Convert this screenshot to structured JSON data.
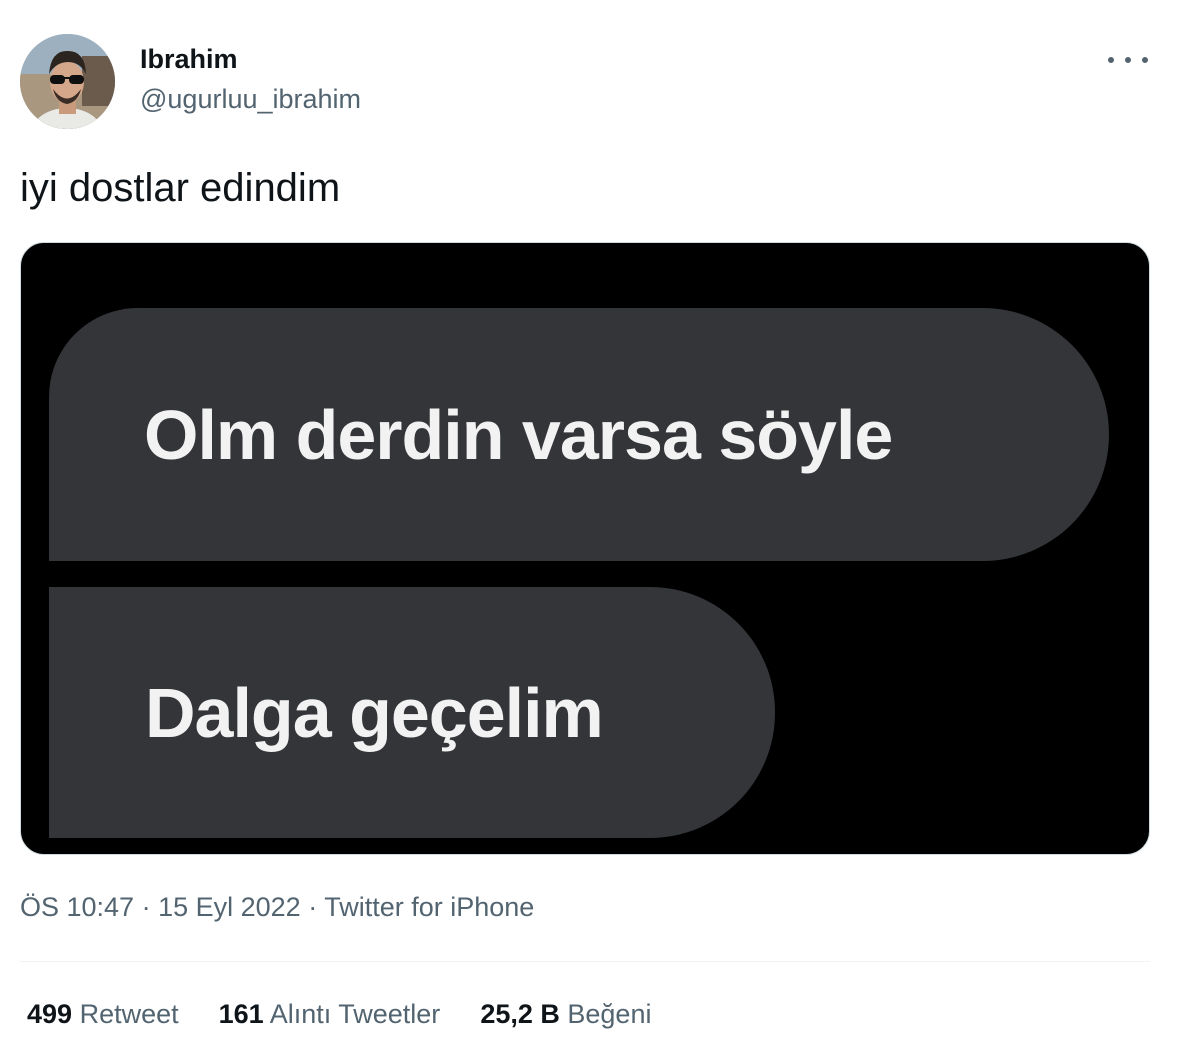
{
  "tweet": {
    "author": {
      "display_name": "Ibrahim",
      "handle": "@ugurluu_ibrahim"
    },
    "text": "iyi dostlar edindim",
    "media": {
      "messages": [
        "Olm derdin varsa söyle",
        "Dalga geçelim"
      ]
    },
    "meta": {
      "time": "ÖS 10:47",
      "separator": " · ",
      "date": "15 Eyl 2022",
      "source": "Twitter for iPhone"
    },
    "stats": [
      {
        "count": "499",
        "label": "Retweet"
      },
      {
        "count": "161",
        "label": "Alıntı Tweetler"
      },
      {
        "count": "25,2 B",
        "label": "Beğeni"
      }
    ],
    "icons": {
      "more": "more-horizontal-icon"
    },
    "colors": {
      "text_primary": "#0f1419",
      "text_secondary": "#536471",
      "bubble": "#333538",
      "media_bg": "#000000",
      "border": "#cfd9de"
    }
  }
}
